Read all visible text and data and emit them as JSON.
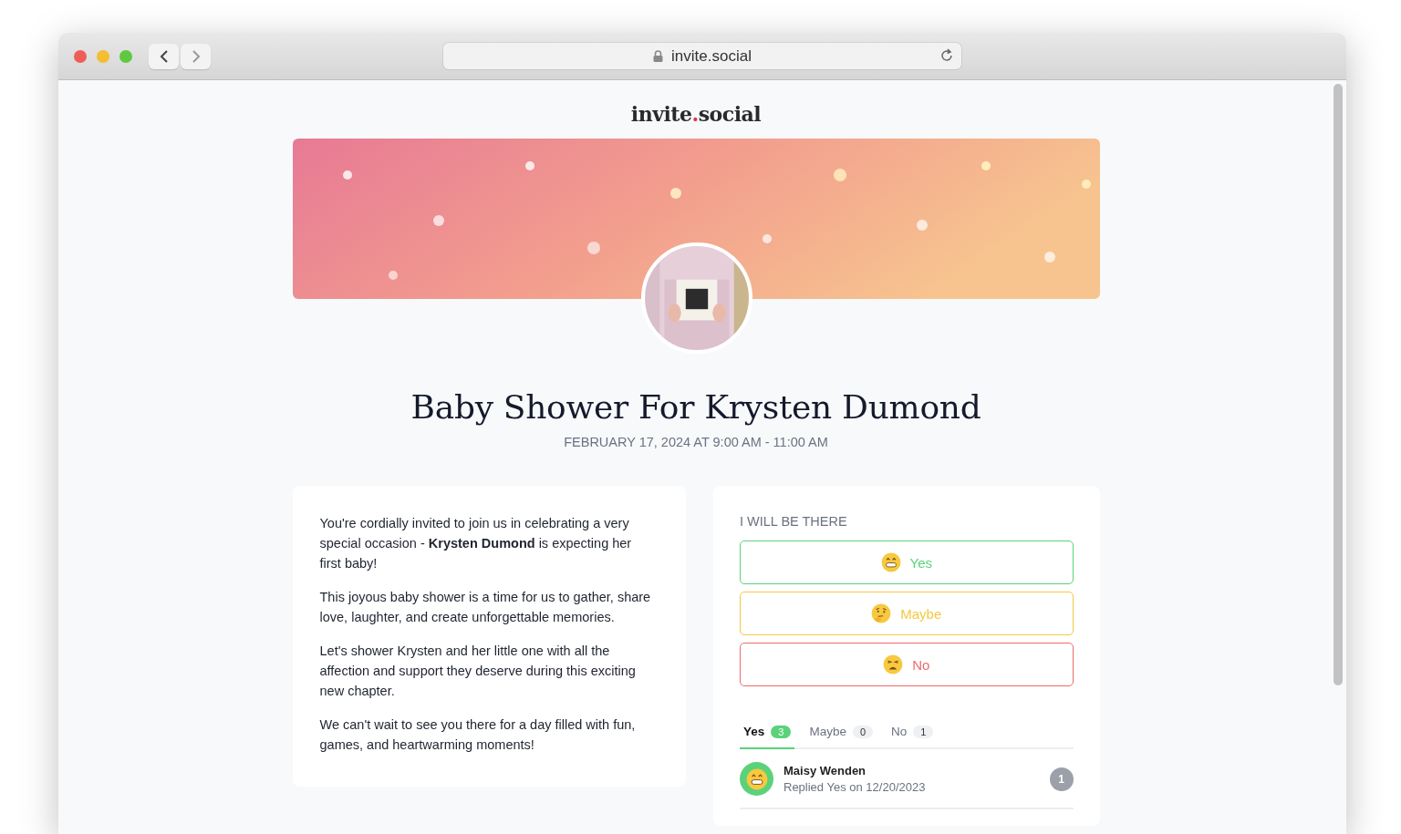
{
  "browser": {
    "url": "invite.social"
  },
  "logo": {
    "name": "invite",
    "dot": ".",
    "suffix": "social"
  },
  "event": {
    "title": "Baby Shower For Krysten Dumond",
    "date": "FEBRUARY 17, 2024 AT 9:00 AM - 11:00 AM"
  },
  "description": [
    "You're cordially invited to join us in celebrating a very special occasion - **Krysten Dumond** is expecting her first baby!",
    "This joyous baby shower is a time for us to gather, share love, laughter, and create unforgettable memories.",
    "Let's shower Krysten and her little one with all the affection and support they deserve during this exciting new chapter.",
    "We can't wait to see you there for a day filled with fun, games, and heartwarming moments!"
  ],
  "rsvp": {
    "heading": "I WILL BE THERE",
    "options": [
      {
        "kind": "yes",
        "label": "Yes"
      },
      {
        "kind": "maybe",
        "label": "Maybe"
      },
      {
        "kind": "no",
        "label": "No"
      }
    ],
    "tabs": [
      {
        "kind": "yes",
        "label": "Yes",
        "count": "3",
        "selected": true
      },
      {
        "kind": "maybe",
        "label": "Maybe",
        "count": "0",
        "selected": false
      },
      {
        "kind": "no",
        "label": "No",
        "count": "1",
        "selected": false
      }
    ],
    "guests": [
      {
        "kind": "yes",
        "name": "Maisy Wenden",
        "reply": "Replied Yes on 12/20/2023",
        "badge": "1"
      }
    ]
  }
}
